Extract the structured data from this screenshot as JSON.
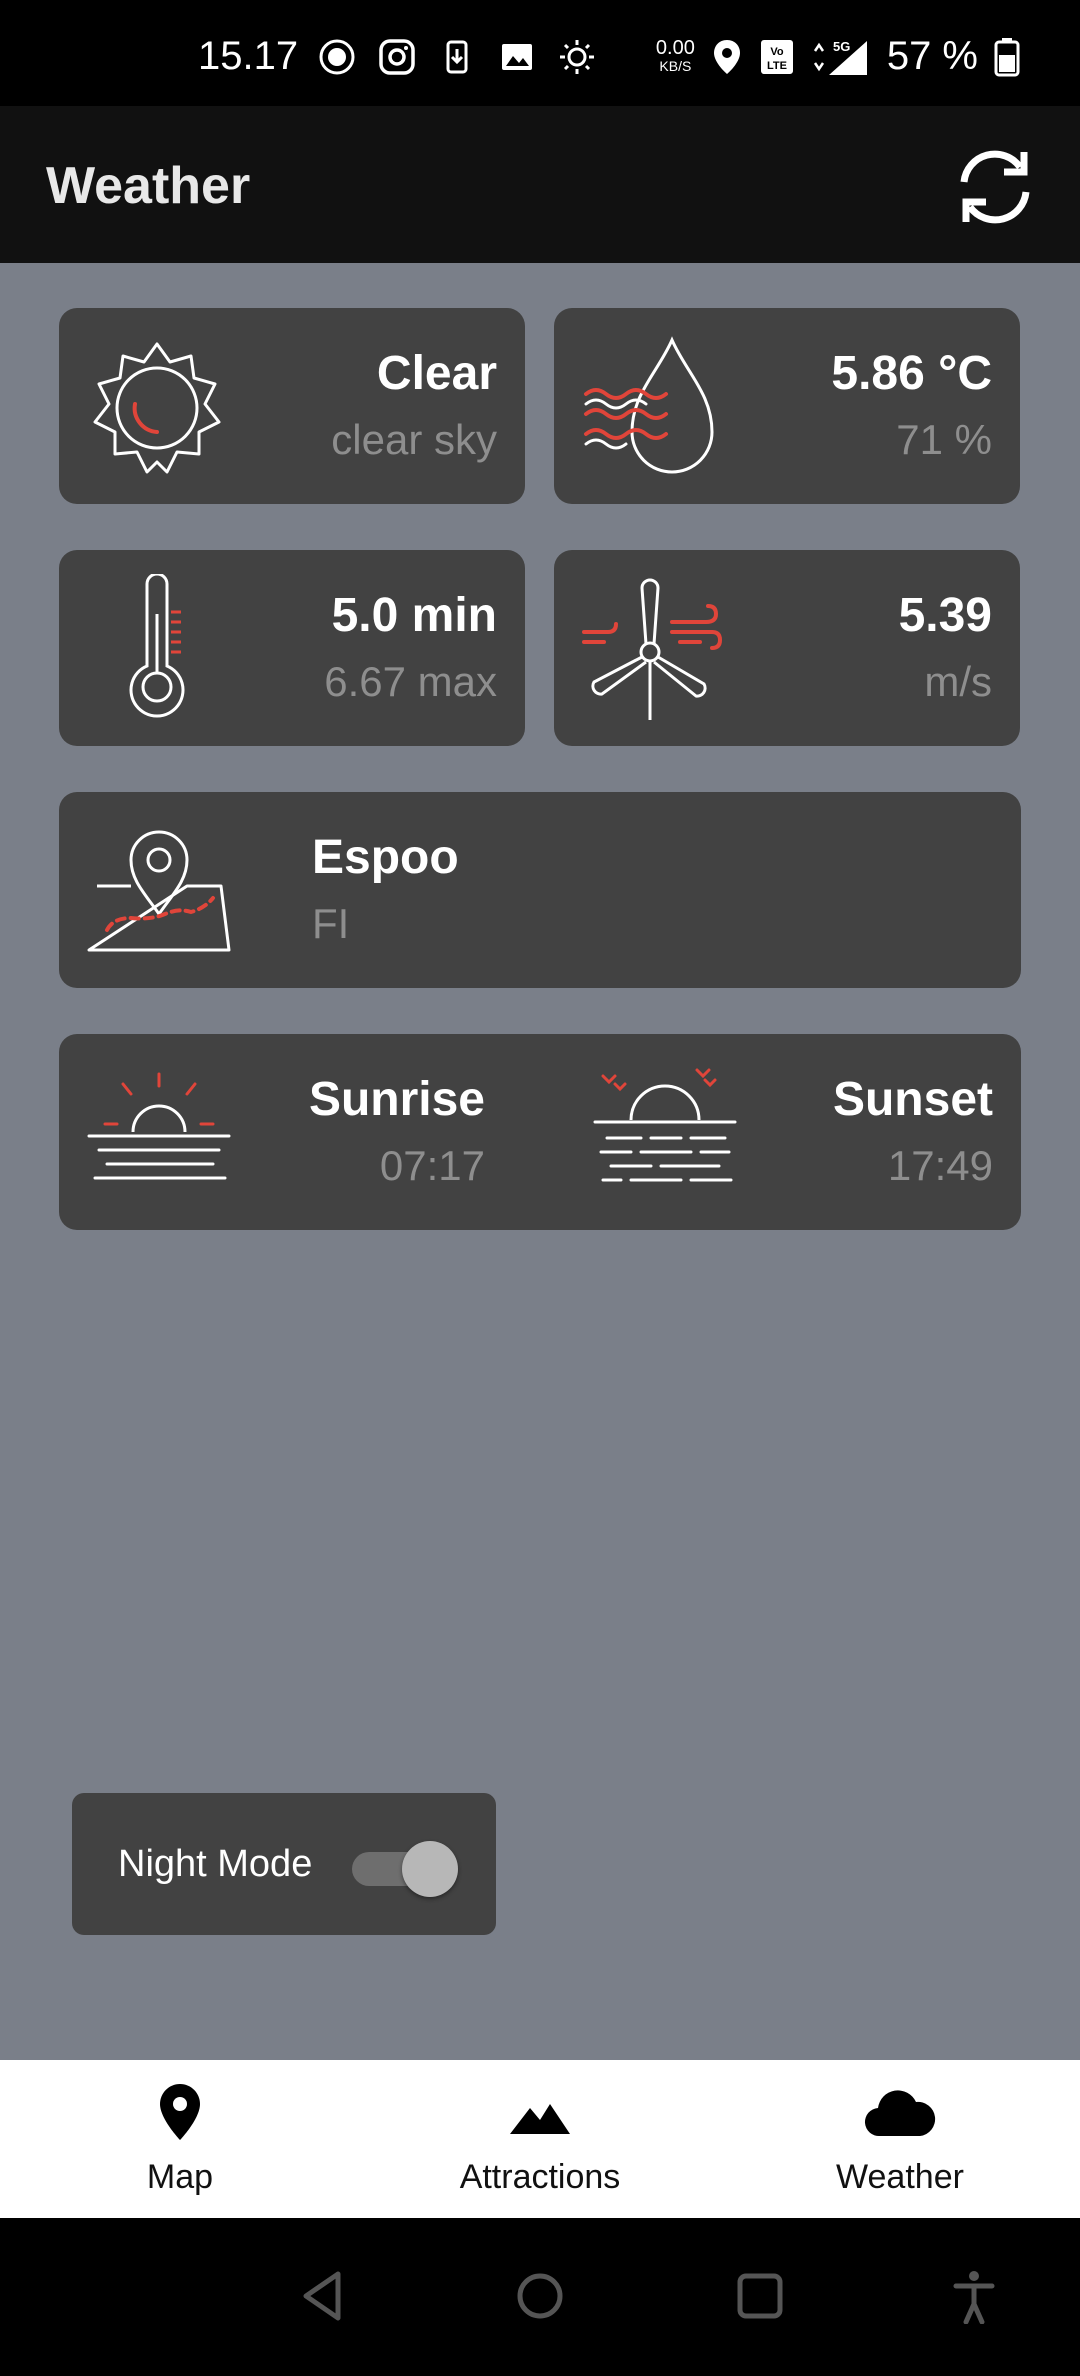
{
  "status_bar": {
    "time": "15.17",
    "network_speed_value": "0.00",
    "network_speed_unit": "KB/S",
    "network_type": "5G",
    "battery": "57 %"
  },
  "app_bar": {
    "title": "Weather"
  },
  "cards": {
    "condition": {
      "main": "Clear",
      "sub": "clear sky"
    },
    "humidity": {
      "main": "5.86 °C",
      "sub": "71 %"
    },
    "temperature": {
      "main": "5.0 min",
      "sub": "6.67 max"
    },
    "wind": {
      "main": "5.39",
      "sub": "m/s"
    },
    "location": {
      "main": "Espoo",
      "sub": "FI"
    },
    "sun": {
      "sunrise_label": "Sunrise",
      "sunrise_time": "07:17",
      "sunset_label": "Sunset",
      "sunset_time": "17:49"
    }
  },
  "night_mode": {
    "label": "Night Mode",
    "enabled": false
  },
  "bottom_nav": {
    "items": [
      {
        "label": "Map",
        "icon": "map-pin-icon"
      },
      {
        "label": "Attractions",
        "icon": "mountains-icon"
      },
      {
        "label": "Weather",
        "icon": "cloud-icon"
      }
    ],
    "selected": "Weather"
  },
  "colors": {
    "accent": "#e0453a",
    "card": "#424242",
    "background": "#7a7f89"
  }
}
